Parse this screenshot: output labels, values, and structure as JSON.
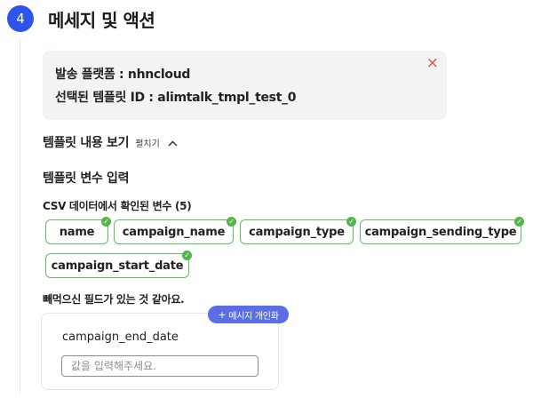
{
  "step": {
    "number": "4",
    "title": "메세지 및 액션"
  },
  "info": {
    "platform_line": "발송 플랫폼 : nhncloud",
    "template_line": "선택된 템플릿 ID : alimtalk_tmpl_test_0",
    "close_icon": "×"
  },
  "preview": {
    "title": "템플릿 내용 보기",
    "toggle": "펼치기",
    "chevron": "^"
  },
  "variables": {
    "title": "템플릿 변수 입력",
    "csv_label": "CSV 데이터에서 확인된 변수 (5)",
    "chips": [
      "name",
      "campaign_name",
      "campaign_type",
      "campaign_sending_type",
      "campaign_start_date"
    ],
    "missing_label": "빼먹으신 필드가 있는 것 같아요.",
    "missing_field": {
      "name": "campaign_end_date",
      "placeholder": "값을 입력해주세요.",
      "value": ""
    },
    "personalize_button": "메시지 개인화",
    "personalize_plus": "+"
  },
  "colors": {
    "accent": "#2f54eb",
    "chip_border": "#5fc45f",
    "check": "#52b64a",
    "close": "#e14b4b",
    "personalize": "#5b6ee8"
  }
}
